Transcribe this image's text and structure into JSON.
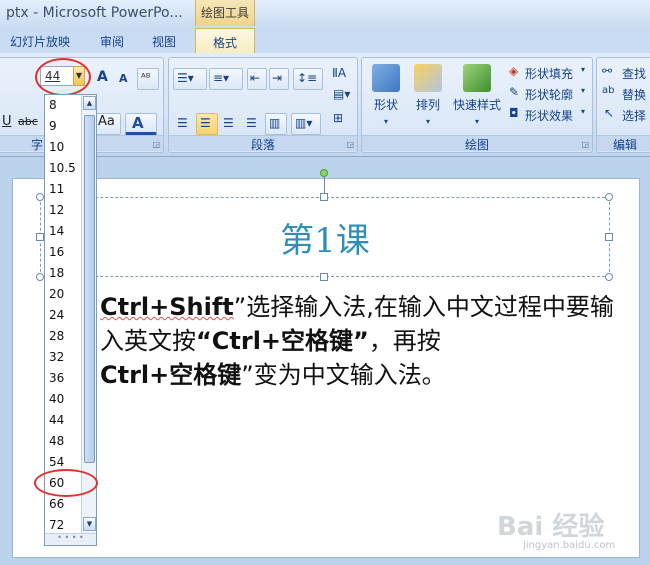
{
  "window": {
    "title": "ptx - Microsoft PowerPo...",
    "context_header": "绘图工具"
  },
  "tabs": [
    "幻灯片放映",
    "审阅",
    "视图",
    "格式"
  ],
  "ribbon": {
    "font_size_value": "44",
    "grow_font": "A",
    "shrink_font": "A",
    "underline": "U",
    "strikethrough": "abc",
    "change_case": "Aa",
    "font_color": "A",
    "font_group_label_partial": "字",
    "paragraph_group_label": "段落",
    "drawing_group_label": "绘图",
    "editing_group_label": "编辑",
    "shapes_label": "形状",
    "arrange_label": "排列",
    "quick_styles_label": "快速样式",
    "shape_fill_label": "形状填充",
    "shape_outline_label": "形状轮廓",
    "shape_effects_label": "形状效果",
    "find_label": "查找",
    "replace_label": "替换",
    "select_label": "选择"
  },
  "font_size_options": [
    "8",
    "9",
    "10",
    "10.5",
    "11",
    "12",
    "14",
    "16",
    "18",
    "20",
    "24",
    "28",
    "32",
    "36",
    "40",
    "44",
    "48",
    "54",
    "60",
    "66",
    "72"
  ],
  "slide": {
    "title": "第1课",
    "body_part1_bold": "Ctrl+Shift",
    "body_part2": "”选择输入法,在输入中文过程中要输入英文按",
    "body_part3_bold": "“Ctrl+空格键”",
    "body_part4": "，再按",
    "body_part5_bold": "Ctrl+空格键",
    "body_part6": "”变为中文输入法。"
  },
  "watermark": {
    "text": "Bai 经验",
    "url": "jingyan.baidu.com"
  },
  "colors": {
    "title_color": "#2f8fb9",
    "annotation_red": "#e03030"
  }
}
